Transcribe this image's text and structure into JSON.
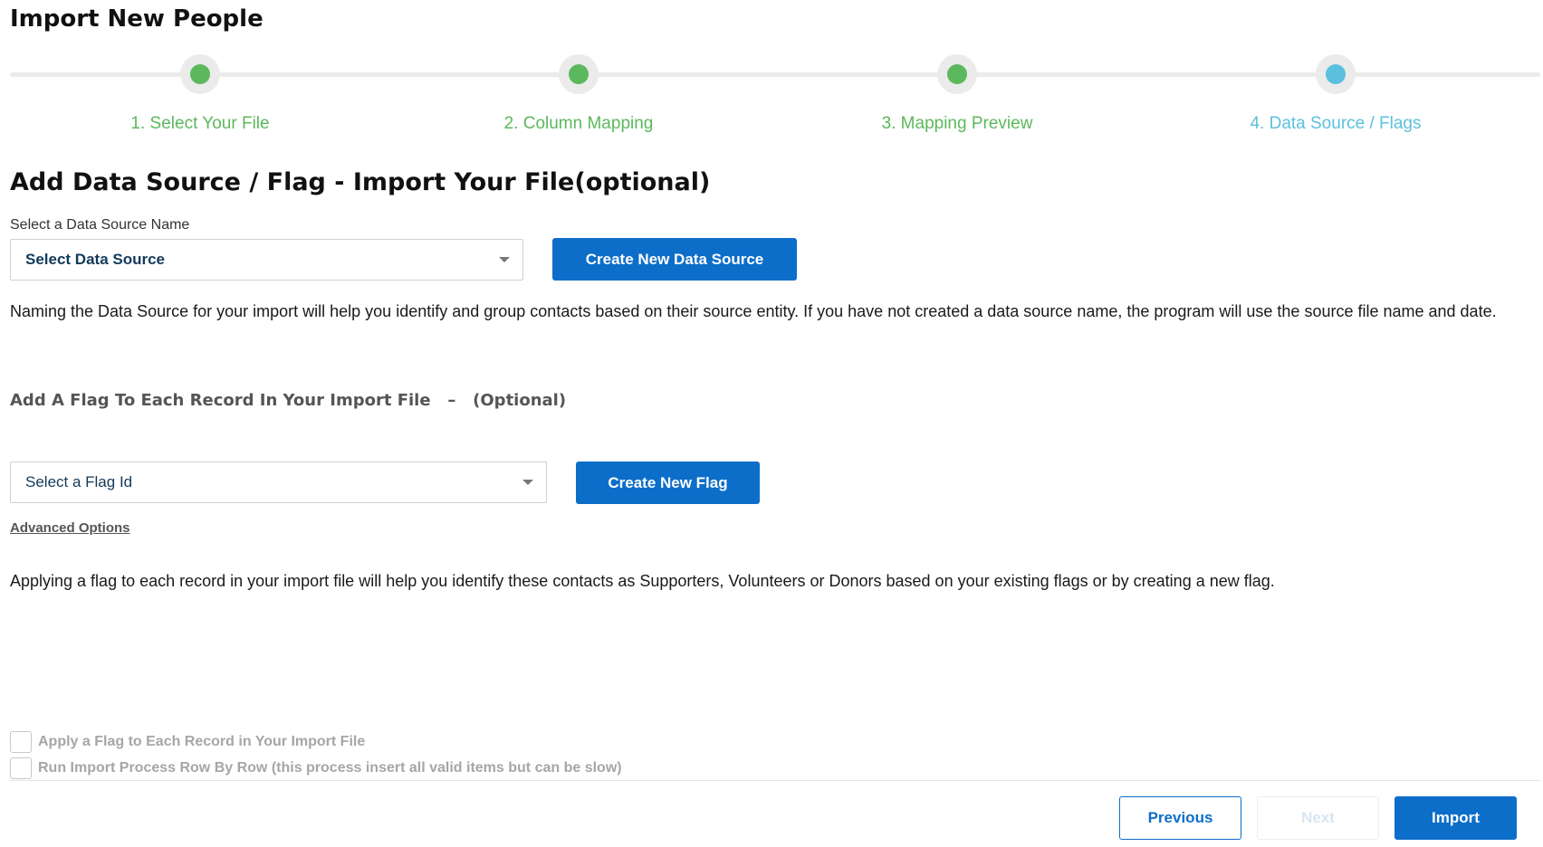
{
  "page": {
    "title": "Import New People"
  },
  "stepper": {
    "steps": [
      {
        "label": "1. Select Your File",
        "status": "complete"
      },
      {
        "label": "2. Column Mapping",
        "status": "complete"
      },
      {
        "label": "3. Mapping Preview",
        "status": "complete"
      },
      {
        "label": "4. Data Source / Flags",
        "status": "active"
      }
    ],
    "colors": {
      "complete": "#5cb85c",
      "active": "#5bc0de",
      "track": "#ebebeb"
    }
  },
  "data_source": {
    "heading": "Add Data Source / Flag - Import Your File(optional)",
    "label": "Select a Data Source Name",
    "select_value": "Select Data Source",
    "create_button": "Create New Data Source",
    "description": "Naming the Data Source for your import will help you identify and group contacts based on their source entity. If you have not created a data source name, the program will use the source file name and date."
  },
  "flag": {
    "heading": "Add A Flag To Each Record In Your Import File   –   (Optional)",
    "select_value": "Select a Flag Id",
    "create_button": "Create New Flag",
    "advanced_link": "Advanced Options",
    "description": "Applying a flag to each record in your import file will help you identify these contacts as Supporters, Volunteers or Donors based on your existing flags or by creating a new flag."
  },
  "options": {
    "apply_flag": "Apply a Flag to Each Record in Your Import File",
    "row_by_row": "Run Import Process Row By Row (this process insert all valid items but can be slow)"
  },
  "footer": {
    "previous": "Previous",
    "next": "Next",
    "import": "Import"
  },
  "colors": {
    "primary": "#0d6ec9"
  }
}
